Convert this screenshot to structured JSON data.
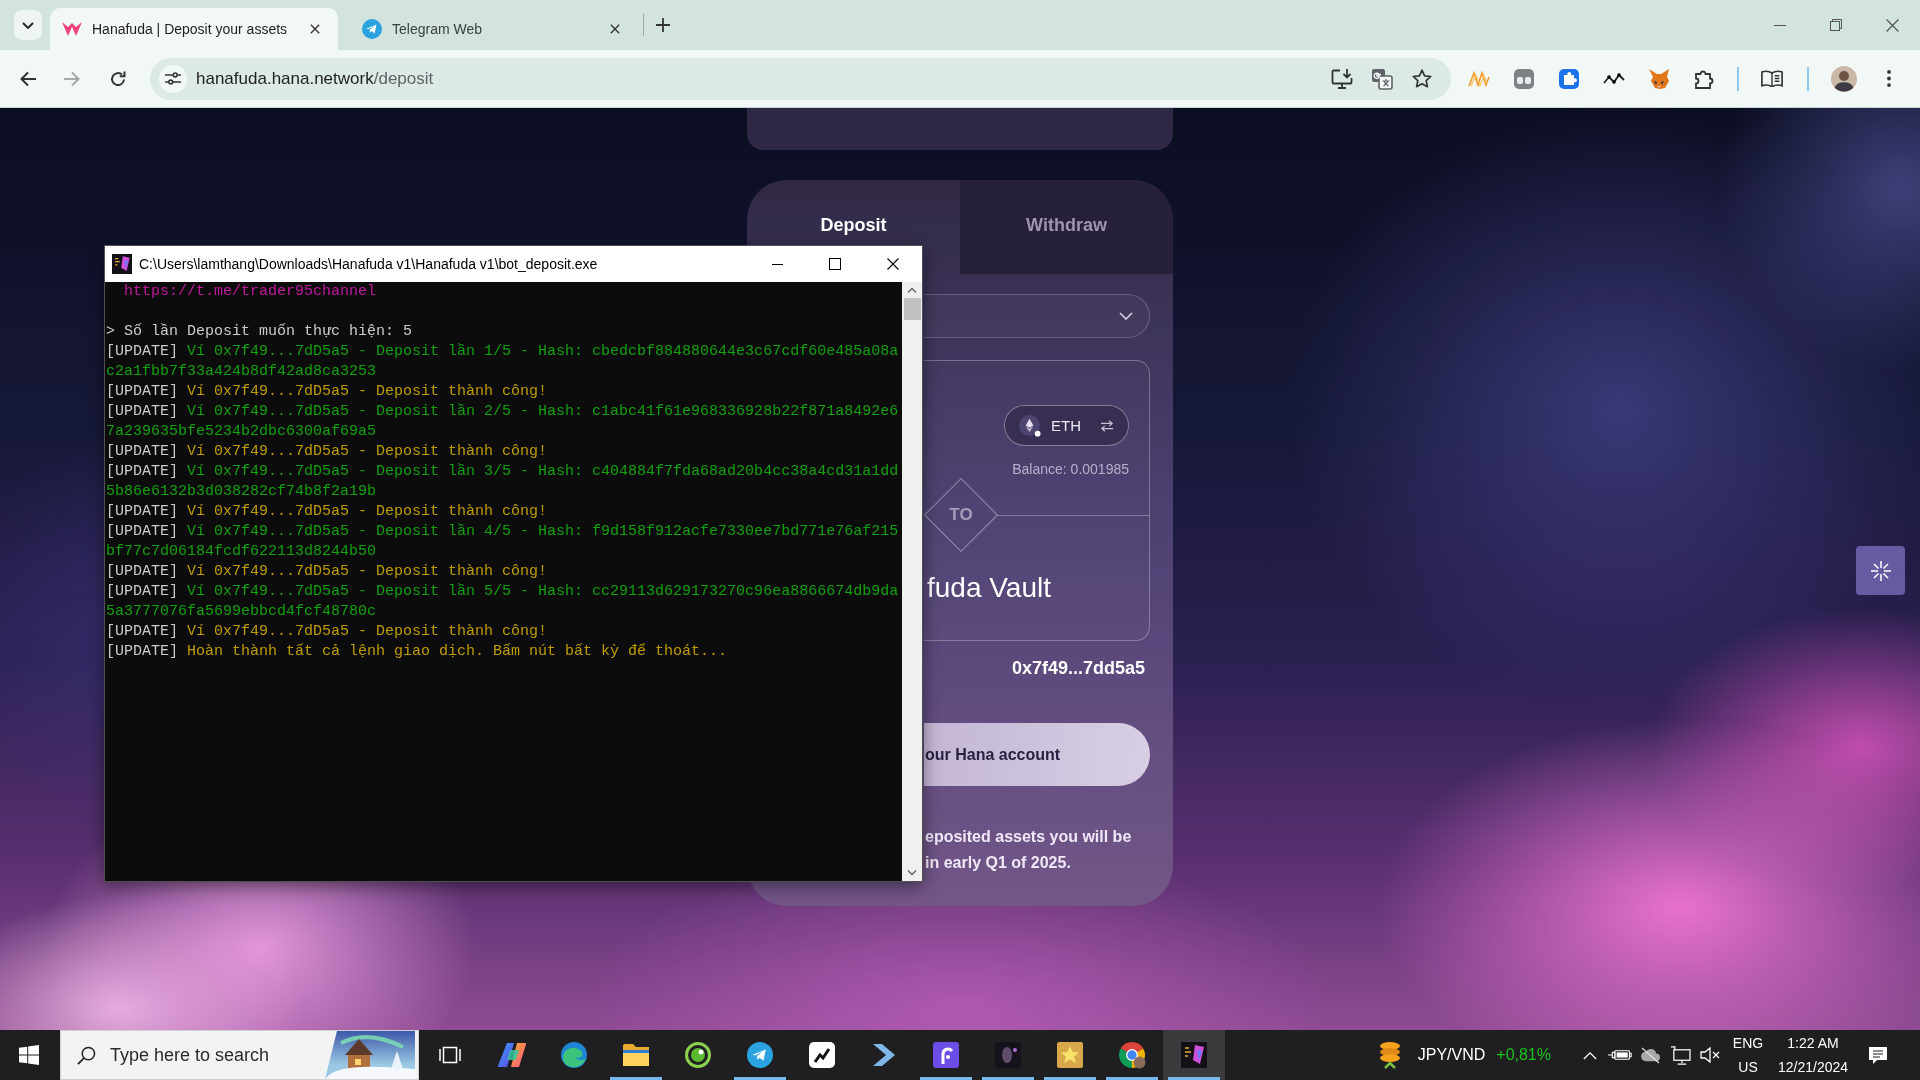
{
  "browser": {
    "tabs": [
      {
        "title": "Hanafuda | Deposit your assets",
        "kind": "wings",
        "selected": true
      },
      {
        "title": "Telegram Web",
        "kind": "paper-plane",
        "selected": false
      }
    ],
    "nav_buttons": [
      {
        "kind": "back",
        "disabled": false
      },
      {
        "kind": "forward",
        "disabled": true
      },
      {
        "kind": "reload",
        "disabled": false
      }
    ],
    "url": {
      "host": "hanafuda.hana.network",
      "path": "/deposit"
    }
  },
  "page": {
    "deposit_card": {
      "tabs": [
        {
          "label": "Deposit",
          "selected": true
        },
        {
          "label": "Withdraw",
          "selected": false
        }
      ],
      "asset": {
        "symbol": "ETH",
        "balance": "Balance: 0.001985"
      },
      "divider_label": "TO",
      "destination": "fuda Vault",
      "address": "0x7f49...7dd5a5",
      "action_button": "our Hana account",
      "notice": [
        "eposited assets you will be",
        "in early Q1 of 2025."
      ]
    }
  },
  "console": {
    "title": "C:\\Users\\lamthang\\Downloads\\Hanafuda v1\\Hanafuda v1\\bot_deposit.exe",
    "lines": [
      {
        "kind": "link",
        "text": "https://t.me/trader95channel"
      },
      {
        "kind": "blank"
      },
      {
        "kind": "prompt",
        "text": "> Số lần Deposit muốn thực hiện: 5"
      },
      {
        "kind": "log",
        "tag": "[UPDATE]",
        "text": "Ví 0x7f49...7dD5a5 - Deposit lần 1/5 - Hash: cbedcbf884880644e3c67cdf60e485a08ac2a1fbb7f33a424b8df42ad8ca3253",
        "color": "#13a10e"
      },
      {
        "kind": "log",
        "tag": "[UPDATE]",
        "text": "Ví 0x7f49...7dD5a5 - Deposit thành công!",
        "color": "#c19c00"
      },
      {
        "kind": "log",
        "tag": "[UPDATE]",
        "text": "Ví 0x7f49...7dD5a5 - Deposit lần 2/5 - Hash: c1abc41f61e968336928b22f871a8492e67a239635bfe5234b2dbc6300af69a5",
        "color": "#13a10e"
      },
      {
        "kind": "log",
        "tag": "[UPDATE]",
        "text": "Ví 0x7f49...7dD5a5 - Deposit thành công!",
        "color": "#c19c00"
      },
      {
        "kind": "log",
        "tag": "[UPDATE]",
        "text": "Ví 0x7f49...7dD5a5 - Deposit lần 3/5 - Hash: c404884f7fda68ad20b4cc38a4cd31a1dd5b86e6132b3d038282cf74b8f2a19b",
        "color": "#13a10e"
      },
      {
        "kind": "log",
        "tag": "[UPDATE]",
        "text": "Ví 0x7f49...7dD5a5 - Deposit thành công!",
        "color": "#c19c00"
      },
      {
        "kind": "log",
        "tag": "[UPDATE]",
        "text": "Ví 0x7f49...7dD5a5 - Deposit lần 4/5 - Hash: f9d158f912acfe7330ee7bd771e76af215bf77c7d06184fcdf622113d8244b50",
        "color": "#13a10e"
      },
      {
        "kind": "log",
        "tag": "[UPDATE]",
        "text": "Ví 0x7f49...7dD5a5 - Deposit thành công!",
        "color": "#c19c00"
      },
      {
        "kind": "log",
        "tag": "[UPDATE]",
        "text": "Ví 0x7f49...7dD5a5 - Deposit lần 5/5 - Hash: cc29113d629173270c96ea8866674db9da5a3777076fa5699ebbcd4fcf48780c",
        "color": "#13a10e"
      },
      {
        "kind": "log",
        "tag": "[UPDATE]",
        "text": "Ví 0x7f49...7dD5a5 - Deposit thành công!",
        "color": "#c19c00"
      },
      {
        "kind": "log",
        "tag": "[UPDATE]",
        "text": "Hoàn thành tất cả lệnh giao dịch. Bấm nút bất kỳ để thoát...",
        "color": "#c19c00"
      }
    ]
  },
  "taskbar": {
    "search": {
      "placeholder": "Type here to search"
    },
    "apps": [
      {
        "kind": "ribbon",
        "running": false,
        "active": false
      },
      {
        "kind": "swirl",
        "running": false,
        "active": false
      },
      {
        "kind": "folder",
        "running": true,
        "active": false
      },
      {
        "kind": "ring-dot",
        "running": false,
        "active": false
      },
      {
        "kind": "paper-plane",
        "running": true,
        "active": false
      },
      {
        "kind": "chart-tile",
        "running": false,
        "active": false
      },
      {
        "kind": "chevron",
        "running": false,
        "active": false
      },
      {
        "kind": "hook-tile",
        "running": true,
        "active": false
      },
      {
        "kind": "dark-tile",
        "running": true,
        "active": false
      },
      {
        "kind": "star-tile",
        "running": true,
        "active": false
      },
      {
        "kind": "chrome",
        "running": true,
        "active": false
      },
      {
        "kind": "console-tile",
        "running": true,
        "active": true
      }
    ],
    "ticker": {
      "pair": "JPY/VND",
      "change": "+0,81%"
    },
    "volume": {
      "muted": true
    },
    "language": {
      "code": "ENG",
      "region": "US"
    },
    "clock": {
      "time": "1:22 AM",
      "date": "12/21/2024"
    }
  }
}
